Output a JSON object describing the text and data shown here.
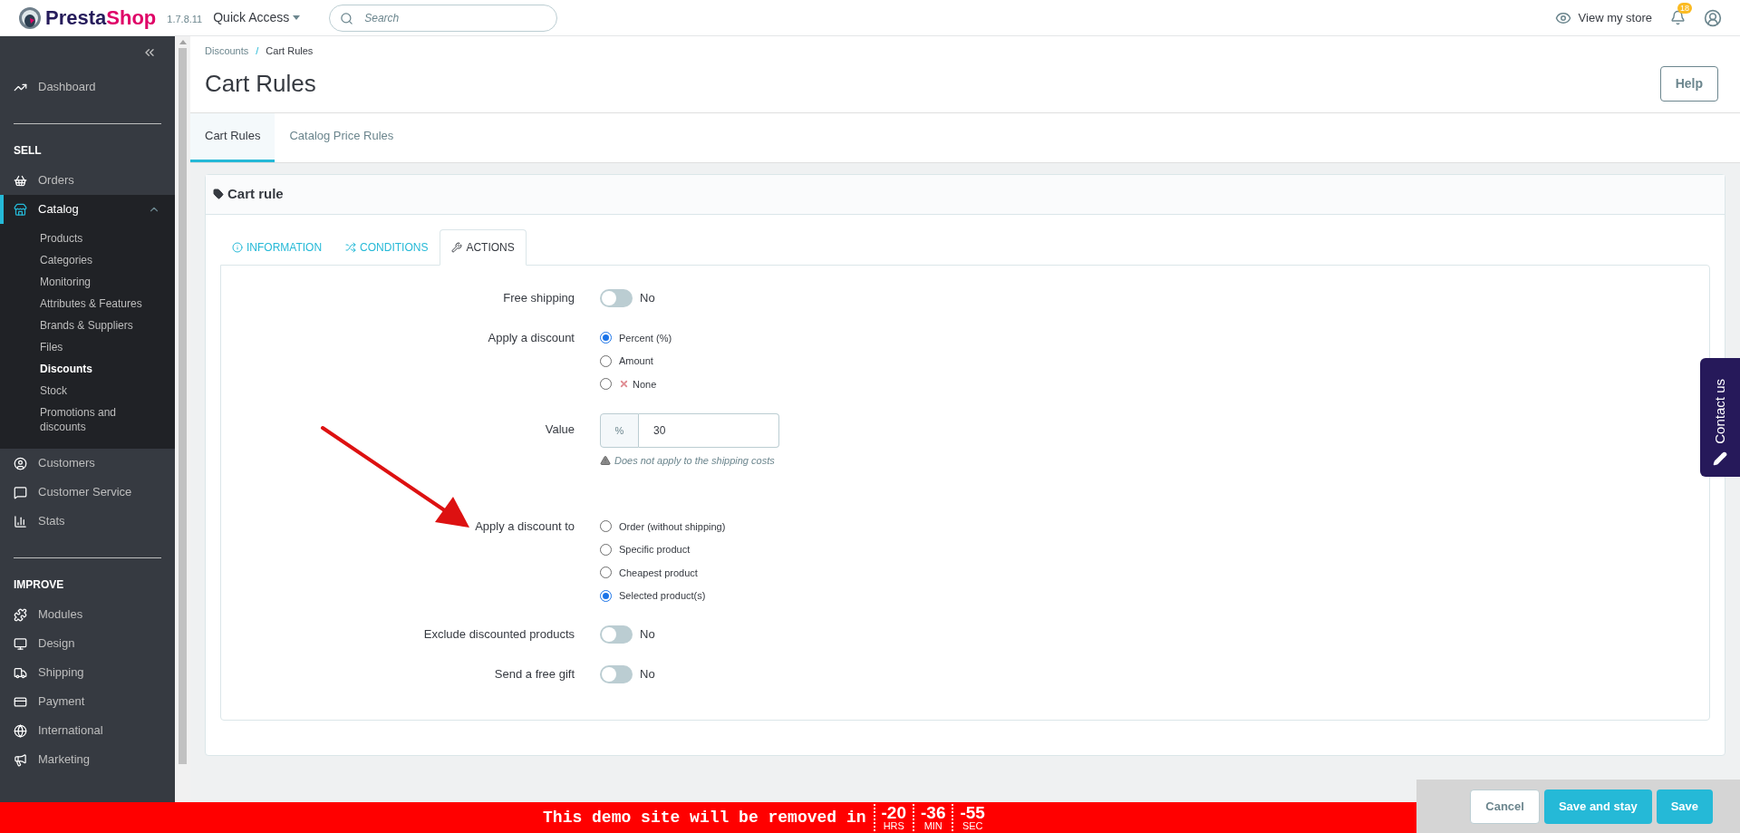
{
  "header": {
    "logo": [
      "Presta",
      "Shop"
    ],
    "version": "1.7.8.11",
    "quick_access": "Quick Access",
    "search": {
      "placeholder": "Search"
    },
    "view_store": "View my store",
    "notifications": "18"
  },
  "sidebar": {
    "items": [
      {
        "kind": "item",
        "label": "Dashboard",
        "selected": false
      },
      {
        "kind": "section",
        "label": "SELL"
      },
      {
        "kind": "item",
        "label": "Orders",
        "selected": false
      },
      {
        "kind": "item",
        "label": "Catalog",
        "selected": true,
        "expanded": true,
        "children": [
          {
            "label": "Products",
            "selected": false
          },
          {
            "label": "Categories",
            "selected": false
          },
          {
            "label": "Monitoring",
            "selected": false
          },
          {
            "label": "Attributes & Features",
            "selected": false
          },
          {
            "label": "Brands & Suppliers",
            "selected": false
          },
          {
            "label": "Files",
            "selected": false
          },
          {
            "label": "Discounts",
            "selected": true
          },
          {
            "label": "Stock",
            "selected": false
          },
          {
            "label": "Promotions and discounts",
            "selected": false
          }
        ]
      },
      {
        "kind": "item",
        "label": "Customers",
        "selected": false
      },
      {
        "kind": "item",
        "label": "Customer Service",
        "selected": false
      },
      {
        "kind": "item",
        "label": "Stats",
        "selected": false
      },
      {
        "kind": "section",
        "label": "IMPROVE"
      },
      {
        "kind": "item",
        "label": "Modules",
        "selected": false
      },
      {
        "kind": "item",
        "label": "Design",
        "selected": false
      },
      {
        "kind": "item",
        "label": "Shipping",
        "selected": false
      },
      {
        "kind": "item",
        "label": "Payment",
        "selected": false
      },
      {
        "kind": "item",
        "label": "International",
        "selected": false
      },
      {
        "kind": "item",
        "label": "Marketing",
        "selected": false
      }
    ]
  },
  "breadcrumb": [
    "Discounts",
    "Cart Rules"
  ],
  "breadcrumb_separator": "/",
  "title": "Cart Rules",
  "help": "Help",
  "page_tabs": [
    {
      "label": "Cart Rules",
      "selected": true
    },
    {
      "label": "Catalog Price Rules",
      "selected": false
    }
  ],
  "card": {
    "title": "Cart rule",
    "tabs": [
      {
        "label": "INFORMATION",
        "selected": false
      },
      {
        "label": "CONDITIONS",
        "selected": false
      },
      {
        "label": "ACTIONS",
        "selected": true
      }
    ],
    "rows": [
      {
        "kind": "toggle",
        "label": "Free shipping",
        "on": false,
        "state_text": "No"
      },
      {
        "kind": "radio",
        "label": "Apply a discount",
        "options": [
          {
            "kind": "plain",
            "label": "Percent (%)",
            "selected": true
          },
          {
            "kind": "plain",
            "label": "Amount",
            "selected": false
          },
          {
            "kind": "cross",
            "label": "None",
            "selected": false
          }
        ]
      },
      {
        "kind": "input",
        "label": "Value",
        "prefix": "%",
        "value": "30",
        "hint": "Does not apply to the shipping costs"
      },
      {
        "kind": "radio",
        "label": "Apply a discount to",
        "options": [
          {
            "kind": "plain",
            "label": "Order (without shipping)",
            "selected": false
          },
          {
            "kind": "plain",
            "label": "Specific product",
            "selected": false
          },
          {
            "kind": "plain",
            "label": "Cheapest product",
            "selected": false
          },
          {
            "kind": "plain",
            "label": "Selected product(s)",
            "selected": true
          }
        ]
      },
      {
        "kind": "toggle",
        "label": "Exclude discounted products",
        "on": false,
        "state_text": "No"
      },
      {
        "kind": "toggle",
        "label": "Send a free gift",
        "on": false,
        "state_text": "No"
      }
    ]
  },
  "footer_buttons": [
    {
      "kind": "secondary",
      "label": "Cancel"
    },
    {
      "kind": "primary",
      "label": "Save and stay"
    },
    {
      "kind": "primary",
      "label": "Save"
    }
  ],
  "demo_banner": {
    "text": "This demo site will be removed in",
    "timer": [
      {
        "value": "-20",
        "unit": "HRS"
      },
      {
        "value": "-36",
        "unit": "MIN"
      },
      {
        "value": "-55",
        "unit": "SEC"
      }
    ]
  },
  "contact": "Contact us"
}
